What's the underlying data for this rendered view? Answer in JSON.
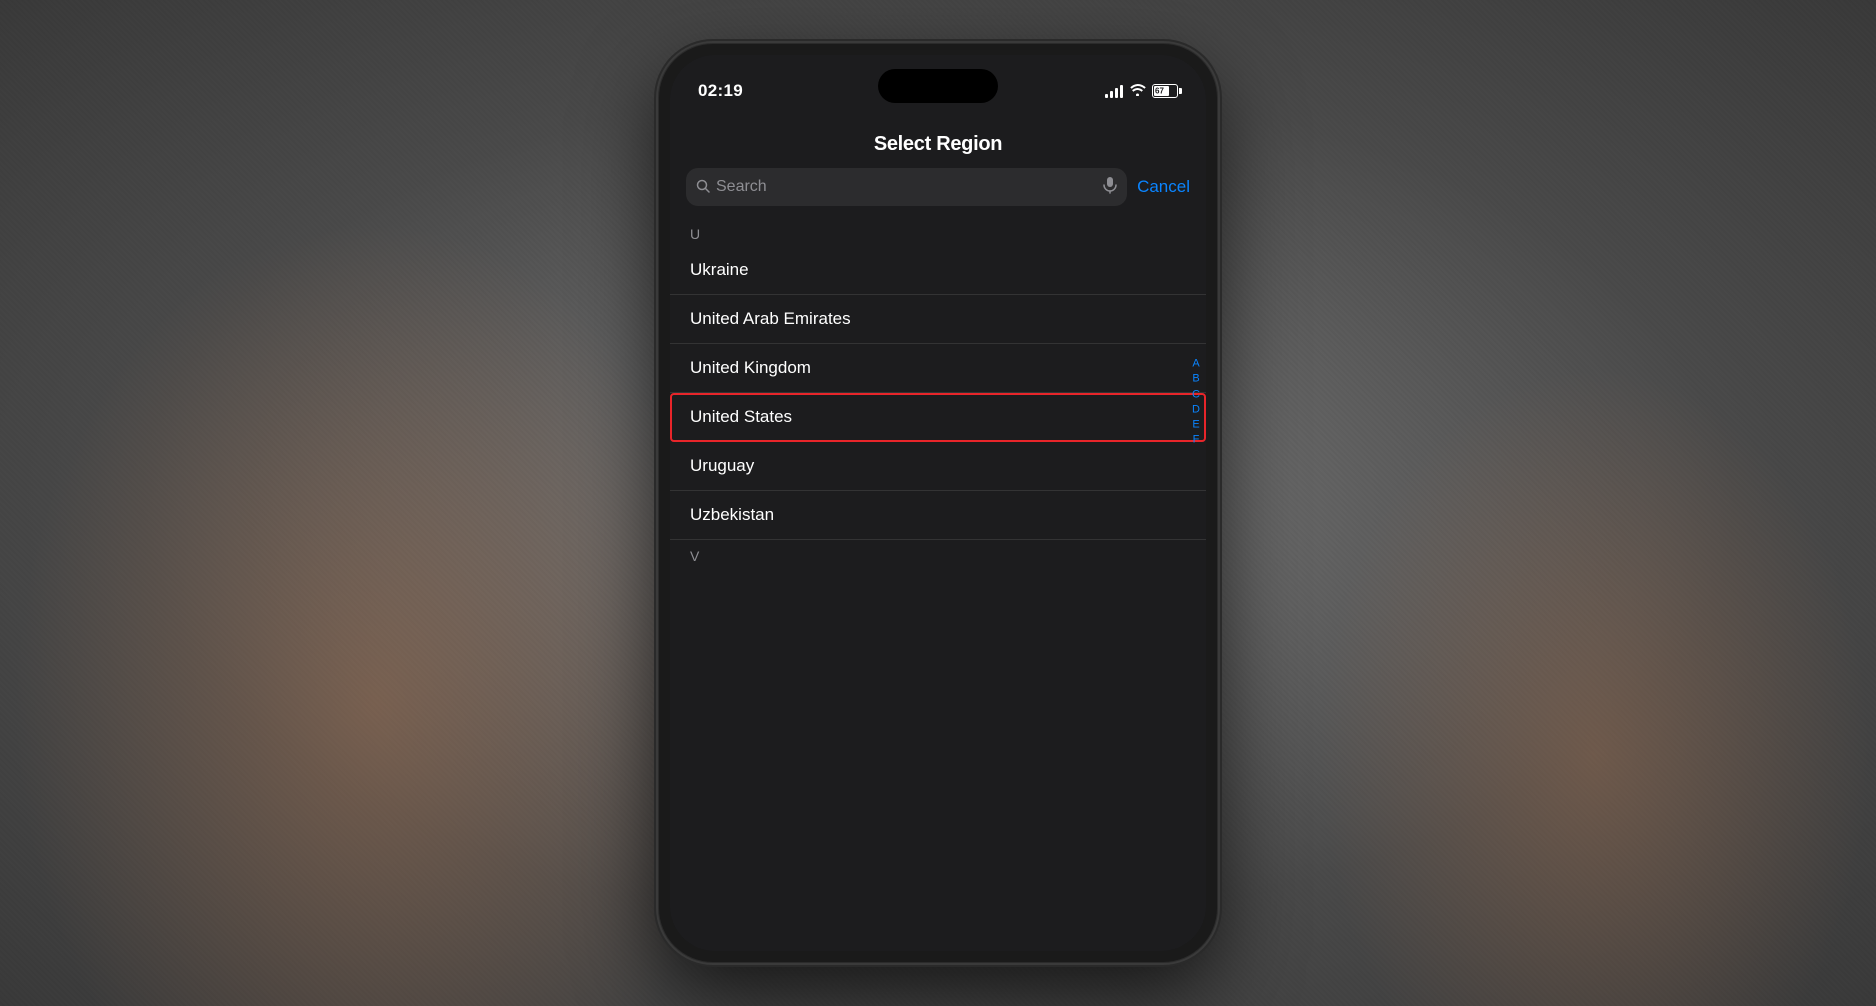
{
  "background": {
    "color": "#5a5a5a"
  },
  "phone": {
    "status_bar": {
      "time": "02:19",
      "signal_label": "signal",
      "wifi_label": "wifi",
      "battery_percent": "67"
    },
    "screen": {
      "title": "Select Region",
      "search_placeholder": "Search",
      "cancel_label": "Cancel",
      "section_u": "U",
      "section_v": "V",
      "countries": [
        {
          "name": "Ukraine",
          "highlighted": false
        },
        {
          "name": "United Arab Emirates",
          "highlighted": false
        },
        {
          "name": "United Kingdom",
          "highlighted": false
        },
        {
          "name": "United States",
          "highlighted": true
        },
        {
          "name": "Uruguay",
          "highlighted": false
        },
        {
          "name": "Uzbekistan",
          "highlighted": false
        }
      ],
      "alphabet_index": [
        "A",
        "B",
        "C",
        "D",
        "E",
        "F"
      ]
    }
  }
}
